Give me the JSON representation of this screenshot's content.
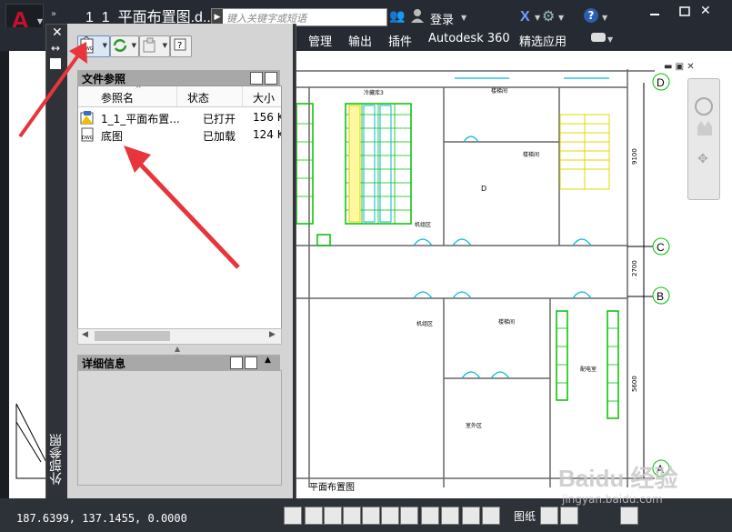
{
  "title_bar": {
    "document_title": "1_1_平面布置图.d...",
    "search_placeholder": "键入关键字或短语",
    "login_label": "登录"
  },
  "ribbon": {
    "tabs": [
      "管理",
      "输出",
      "插件",
      "Autodesk 360",
      "精选应用"
    ]
  },
  "palette": {
    "vertical_title": "外部参照",
    "file_references": {
      "section_title": "文件参照",
      "columns": [
        "参照名",
        "状态",
        "大小"
      ],
      "rows": [
        {
          "name": "1_1_平面布置...",
          "status": "已打开",
          "size": "156 K",
          "icon": "dwg-open-icon"
        },
        {
          "name": "底图",
          "status": "已加载",
          "size": "124 K",
          "icon": "dwg-xref-icon"
        }
      ]
    },
    "details": {
      "section_title": "详细信息"
    }
  },
  "drawing": {
    "grid_labels": [
      "D",
      "C",
      "B",
      "A"
    ],
    "dims": [
      "9100",
      "2700",
      "5600"
    ],
    "room_d": "D",
    "title_text": "平面布置图",
    "room_labels": [
      "冷藏库3",
      "楼梯间",
      "楼梯间",
      "机组区",
      "机组区",
      "楼梯间",
      "配电室",
      "室外区"
    ]
  },
  "status_bar": {
    "coordinates": "187.6399, 137.1455, 0.0000",
    "model_label": "图纸"
  },
  "watermark": {
    "logo": "Baidu 经验",
    "sub": "jingyan.baidu.com"
  },
  "colors": {
    "annotation_arrow": "#e8353b",
    "app_red": "#c8102e",
    "cad_green": "#00c000",
    "cad_cyan": "#00b8d4"
  }
}
